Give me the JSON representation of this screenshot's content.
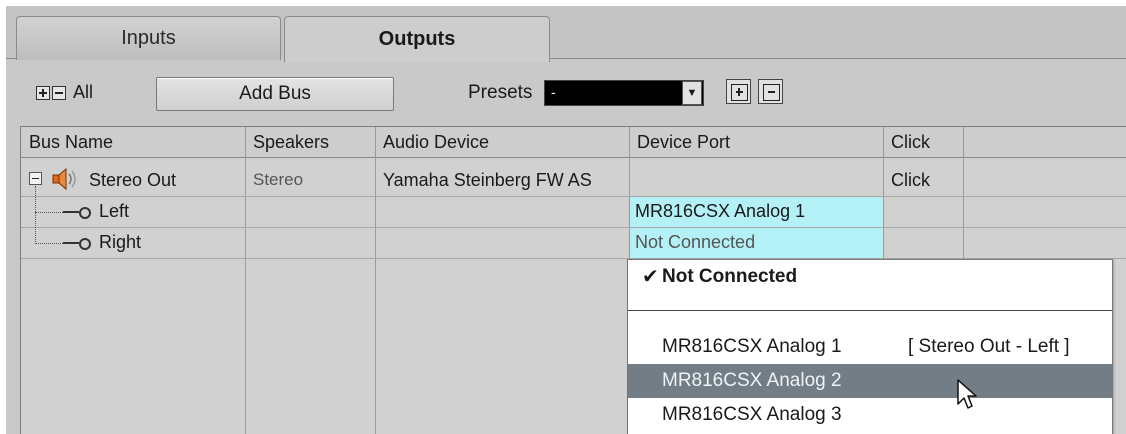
{
  "tabs": [
    {
      "label": "Inputs",
      "active": false
    },
    {
      "label": "Outputs",
      "active": true
    }
  ],
  "toolbar": {
    "expand_all_label": "All",
    "add_bus_label": "Add Bus",
    "presets_label": "Presets",
    "presets_value": "-"
  },
  "table": {
    "headers": [
      "Bus Name",
      "Speakers",
      "Audio Device",
      "Device Port",
      "Click"
    ],
    "bus": {
      "name": "Stereo Out",
      "speakers": "Stereo",
      "audio_device": "Yamaha Steinberg FW AS",
      "click": "Click"
    },
    "channels": [
      {
        "name": "Left",
        "port": "MR816CSX Analog 1"
      },
      {
        "name": "Right",
        "port": "Not Connected"
      }
    ]
  },
  "dropdown": {
    "items": [
      {
        "label": "Not Connected",
        "checked": true
      },
      {
        "label": "MR816CSX Analog 1",
        "assigned": "[ Stereo Out - Left ]"
      },
      {
        "label": "MR816CSX Analog 2",
        "highlighted": true
      },
      {
        "label": "MR816CSX Analog 3"
      }
    ]
  },
  "colors": {
    "selected_port_cell": "#b4f1f6",
    "menu_highlight": "#737d86",
    "panel": "#c9c9c9"
  },
  "icons": [
    "expand-all-icon",
    "collapse-all-icon",
    "store-preset-icon",
    "remove-preset-icon",
    "speaker-icon",
    "port-icon",
    "checkmark-icon",
    "mouse-cursor-icon"
  ]
}
